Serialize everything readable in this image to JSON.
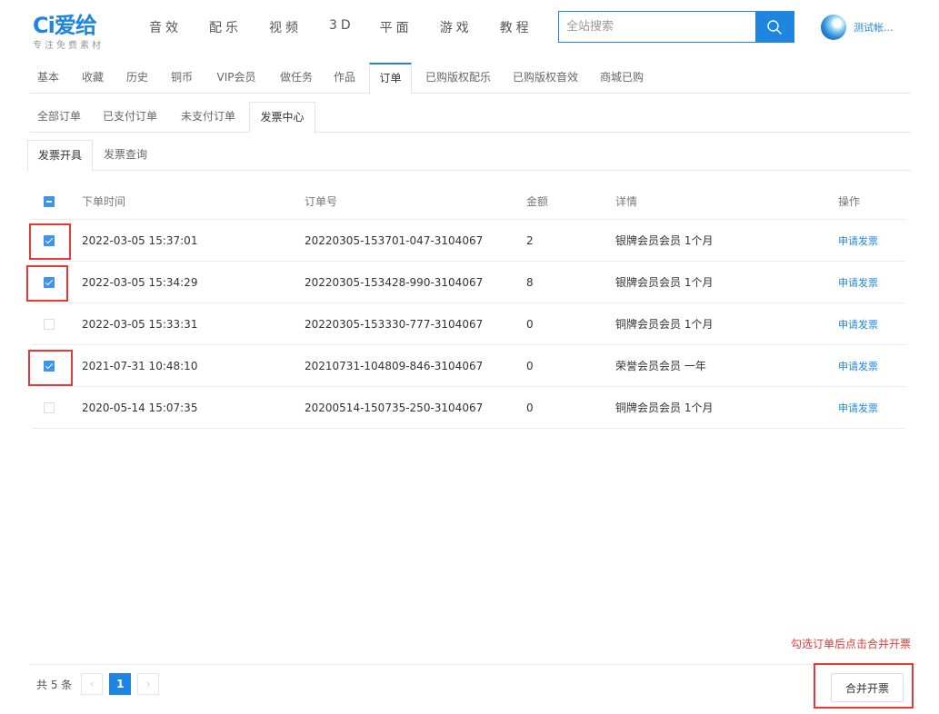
{
  "header": {
    "logo_text": "Ci爱给",
    "logo_tagline": "专注免费素材",
    "nav": [
      "音效",
      "配乐",
      "视频",
      "3D",
      "平面",
      "游戏",
      "教程"
    ],
    "search_placeholder": "全站搜索",
    "search_icon": "search-icon",
    "user_name": "测试帐..."
  },
  "main_tabs": {
    "items": [
      "基本",
      "收藏",
      "历史",
      "铜币",
      "VIP会员",
      "做任务",
      "作品",
      "订单",
      "已购版权配乐",
      "已购版权音效",
      "商城已购"
    ],
    "active": "订单"
  },
  "sub_tabs": {
    "items": [
      "全部订单",
      "已支付订单",
      "未支付订单",
      "发票中心"
    ],
    "active": "发票中心"
  },
  "invoice_tabs": {
    "items": [
      "发票开具",
      "发票查询"
    ],
    "active": "发票开具"
  },
  "table": {
    "columns": [
      "下单时间",
      "订单号",
      "金额",
      "详情",
      "操作"
    ],
    "header_checkbox": "partial",
    "rows": [
      {
        "time": "2022-03-05 15:37:01",
        "order_no": "20220305-153701-047-3104067",
        "amount": "2",
        "detail": "银牌会员会员 1个月",
        "action": "申请发票",
        "checked": true
      },
      {
        "time": "2022-03-05 15:34:29",
        "order_no": "20220305-153428-990-3104067",
        "amount": "8",
        "detail": "银牌会员会员 1个月",
        "action": "申请发票",
        "checked": true
      },
      {
        "time": "2022-03-05 15:33:31",
        "order_no": "20220305-153330-777-3104067",
        "amount": "0",
        "detail": "铜牌会员会员 1个月",
        "action": "申请发票",
        "checked": false
      },
      {
        "time": "2021-07-31 10:48:10",
        "order_no": "20210731-104809-846-3104067",
        "amount": "0",
        "detail": "荣誉会员会员 一年",
        "action": "申请发票",
        "checked": true
      },
      {
        "time": "2020-05-14 15:07:35",
        "order_no": "20200514-150735-250-3104067",
        "amount": "0",
        "detail": "铜牌会员会员 1个月",
        "action": "申请发票",
        "checked": false
      }
    ]
  },
  "pagination": {
    "total_text": "共 5 条",
    "prev": "‹",
    "current_page": "1",
    "next": "›"
  },
  "hint_text": "勾选订单后点击合并开票",
  "merge_button": "合并开票",
  "colors": {
    "accent": "#1e86e0",
    "highlight": "#e53935"
  }
}
